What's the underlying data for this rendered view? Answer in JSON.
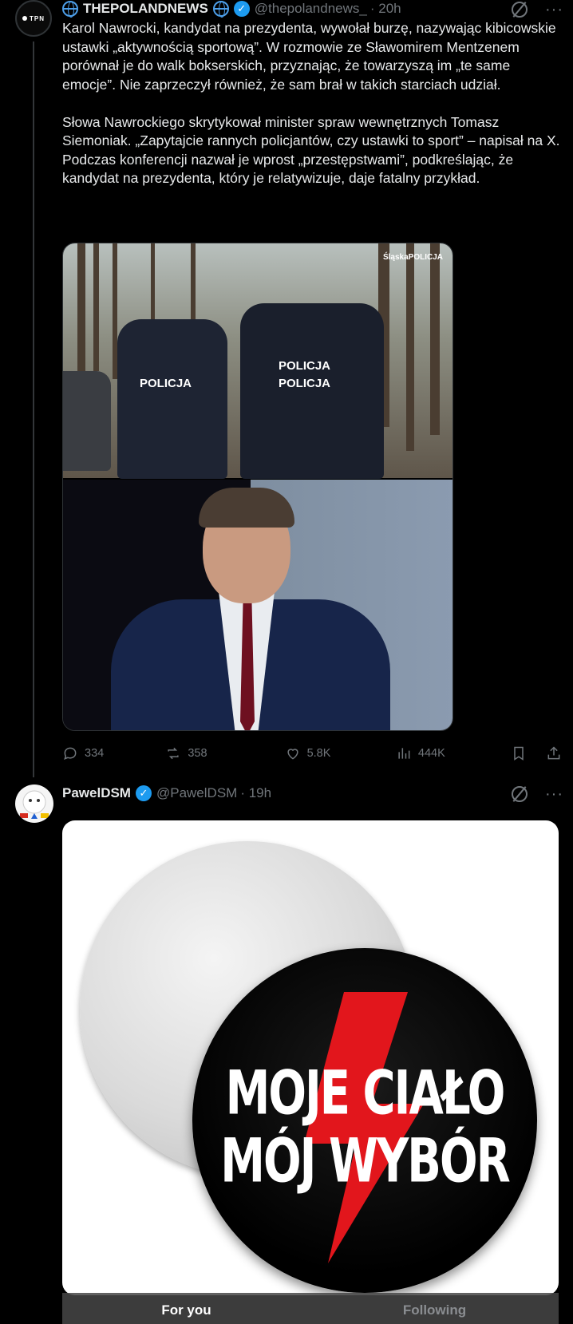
{
  "tweet1": {
    "display_name": "THEPOLANDNEWS",
    "handle": "@thepolandnews_",
    "time": "· 20h",
    "avatar_text": "TPN",
    "text": "Karol Nawrocki, kandydat na prezydenta, wywołał burzę, nazywając kibicowskie ustawki „aktywnością sportową”. W rozmowie ze Sławomirem Mentzenem porównał je do walk bokserskich, przyznając, że towarzyszą im „te same emocje”. Nie zaprzeczył również, że sam brał w takich starciach udział.\n\nSłowa Nawrockiego skrytykował minister spraw wewnętrznych Tomasz Siemoniak. „Zapytajcie rannych policjantów, czy ustawki to sport” – napisał na X. Podczas konferencji nazwał je wprost „przestępstwami”, podkreślając, że kandydat na prezydenta, który je relatywizuje, daje fatalny przykład.",
    "media": {
      "watermark": "ŚląskaPOLICJA",
      "officer_left_label": "POLICJA",
      "officer_right_label": "POLICJA\nPOLICJA"
    },
    "actions": {
      "replies": "334",
      "reposts": "358",
      "likes": "5.8K",
      "views": "444K"
    }
  },
  "tweet2": {
    "display_name": "PawelDSM",
    "handle": "@PawelDSM",
    "time": "· 19h",
    "badge_line1": "MOJE CIAŁO",
    "badge_line2": "MÓJ WYBÓR"
  },
  "tabs": {
    "for_you": "For you",
    "following": "Following"
  },
  "colors": {
    "background": "#000000",
    "verified": "#1d9bf0",
    "muted": "#71767b",
    "bolt": "#e2161c"
  }
}
